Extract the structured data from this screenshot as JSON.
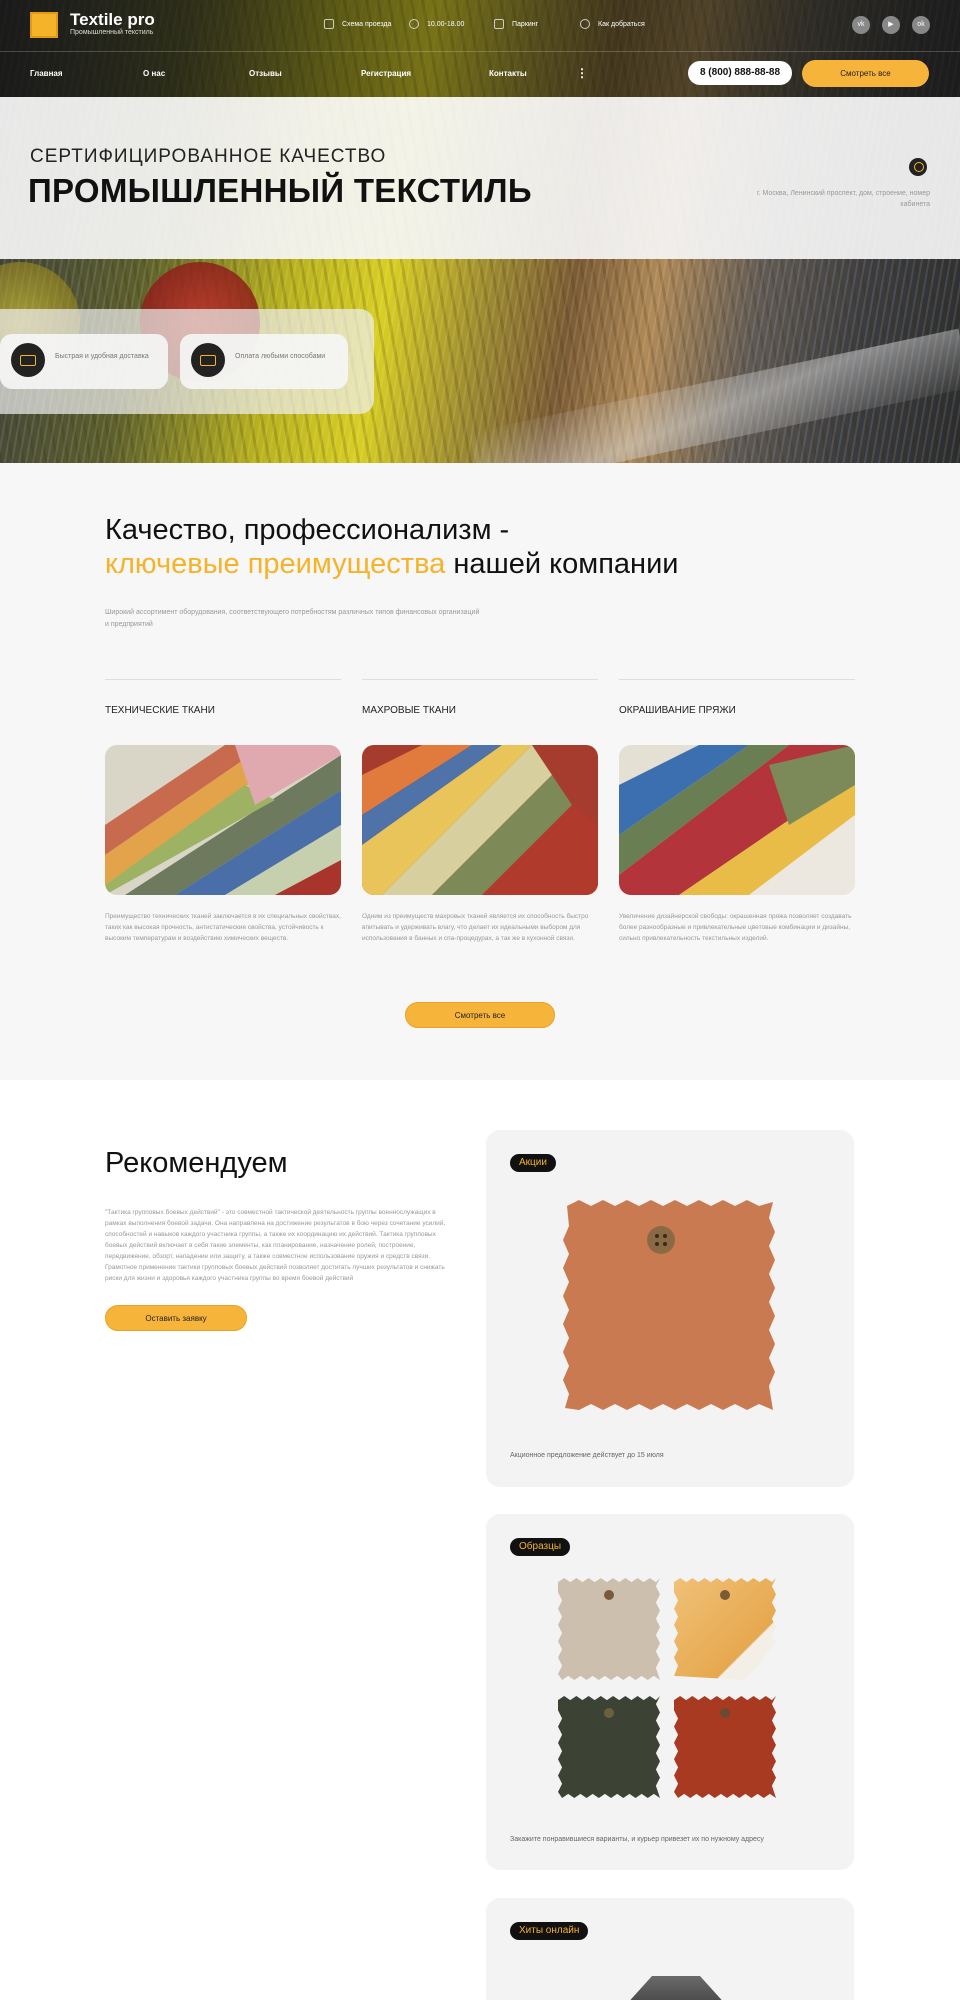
{
  "header": {
    "logo_title": "Textile pro",
    "logo_subtitle": "Промышленный текстиль",
    "info": [
      {
        "icon": "map-icon",
        "label": "Схема проезда"
      },
      {
        "icon": "clock-icon",
        "label": "10.00-18.00"
      },
      {
        "icon": "parking-icon",
        "label": "Паркинг"
      },
      {
        "icon": "location-icon",
        "label": "Как добраться"
      }
    ],
    "social": [
      {
        "icon": "vk-icon",
        "label": "vk"
      },
      {
        "icon": "youtube-icon",
        "label": "▶"
      },
      {
        "icon": "ok-icon",
        "label": "ok"
      }
    ],
    "nav": [
      "Главная",
      "О нас",
      "Отзывы",
      "Регистрация",
      "Контакты"
    ],
    "more": "⋮",
    "phone": "8 (800) 888-88-88",
    "view_all": "Смотреть все"
  },
  "banner": {
    "subtitle": "СЕРТИФИЦИРОВАННОЕ КАЧЕСТВО",
    "title": "ПРОМЫШЛЕННЫЙ ТЕКСТИЛЬ",
    "address": "г. Москва, Ленинский проспект, дом, строение, номер кабинета"
  },
  "features": [
    {
      "icon": "truck-icon",
      "text": "Быстрая и удобная доставка"
    },
    {
      "icon": "wallet-icon",
      "text": "Оплата любыми способами"
    }
  ],
  "quality": {
    "line1": "Качество, профессионализм -",
    "accent": "ключевые преимущества",
    "line2_rest": " нашей компании",
    "description": "Широкий ассортимент оборудования, соответствующего потребностям различных типов финансовых организаций и предприятий",
    "columns": [
      {
        "title": "ТЕХНИЧЕСКИЕ ТКАНИ",
        "desc": "Преимущество технических тканей заключается в их специальных свойствах, таких как высокая прочность, антистатические свойства, устойчивость к высоким температурам и воздействию химических веществ."
      },
      {
        "title": "МАХРОВЫЕ ТКАНИ",
        "desc": "Одним из преимуществ махровых тканей является их способность быстро впитывать и удерживать влагу, что делает их идеальными выбором для использования в банных и спа-процедурах, а так же в кухонной связи."
      },
      {
        "title": "ОКРАШИВАНИЕ ПРЯЖИ",
        "desc": "Увеличение дизайнерской свободы: окрашенная пряжа позволяет создавать более разнообразные и привлекательные цветовые комбинации и дизайны, сильно  привлекательность текстильных изделий."
      }
    ],
    "button": "Смотреть все"
  },
  "recommend": {
    "title": "Рекомендуем",
    "description": "\"Тактика групповых боевых действий\" - это совместной тактической деятельность группы военнослужащих в рамках выполнения боевой задачи. Она направлена на достижение результатов в бою через сочетание усилий, способностей и навыков каждого участника группы, а также их координацию их действий. Тактика групповых боевых действий включает в себя такие элементы, как планирование, назначение ролей, построение, передвижение, обзорт, нападение или защиту, а также совместное использование оружия и средств связи. Грамотное применение тактики групповых боевых действий позволяет достигать лучших результатов и снижать риски для жизни и здоровья каждого участника группы во время боевой действий",
    "button": "Оставить заявку",
    "cards": [
      {
        "tag": "Акции",
        "note": "Акционное предложение действует до 15 июля"
      },
      {
        "tag": "Образцы",
        "note": "Закажите понравившиеся варианты, и курьер привезет их по нужному адресу"
      },
      {
        "tag": "Хиты онлайн",
        "note": ""
      }
    ]
  },
  "colors": {
    "accent": "#f5b32a",
    "dark": "#111111"
  }
}
